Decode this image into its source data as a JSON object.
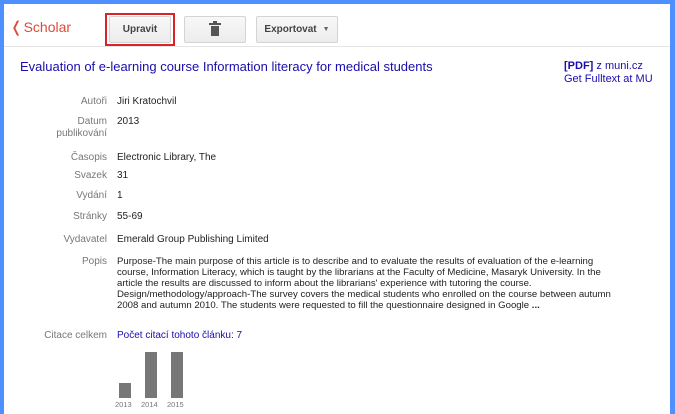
{
  "toolbar": {
    "back_label": "Scholar",
    "edit_label": "Upravit",
    "export_label": "Exportovat"
  },
  "article": {
    "title": "Evaluation of e-learning course Information literacy for medical students",
    "pdf_tag": "[PDF]",
    "pdf_source": "z muni.cz",
    "fulltext_link": "Get Fulltext at MU"
  },
  "fields": {
    "authors": {
      "label": "Autoři",
      "value": "Jiri Kratochvil"
    },
    "date": {
      "label_line1": "Datum",
      "label_line2": "publikování",
      "value": "2013"
    },
    "journal": {
      "label": "Časopis",
      "value": "Electronic Library, The"
    },
    "volume": {
      "label": "Svazek",
      "value": "31"
    },
    "issue": {
      "label": "Vydání",
      "value": "1"
    },
    "pages": {
      "label": "Stránky",
      "value": "55-69"
    },
    "publisher": {
      "label": "Vydavatel",
      "value": "Emerald Group Publishing Limited"
    },
    "description": {
      "label": "Popis",
      "lines": [
        "Purpose-The main purpose of this article is to describe and to evaluate the results of evaluation of the e-learning",
        "course, Information Literacy, which is taught by the librarians at the Faculty of Medicine, Masaryk University. In the",
        "article the results are discussed to inform about the librarians' experience with tutoring the course.",
        "Design/methodology/approach-The survey covers the medical students who enrolled on the course between autumn",
        "2008 and autumn 2010. The students were requested to fill the questionnaire designed in Google"
      ],
      "more": "..."
    },
    "citations": {
      "label": "Citace celkem",
      "link": "Počet citací tohoto článku: 7"
    }
  },
  "citation_chart": {
    "years": [
      "2013",
      "2014",
      "2015"
    ],
    "values": [
      1,
      3,
      3
    ],
    "bar_color": "#777777"
  },
  "colors": {
    "frame": "#4d90fe",
    "link": "#1a0dab",
    "scholar": "#dd4b39",
    "highlight": "#d8232a"
  },
  "icons": {
    "delete": "trash-icon",
    "export_caret": "caret-down-icon",
    "back": "chevron-left-icon"
  }
}
